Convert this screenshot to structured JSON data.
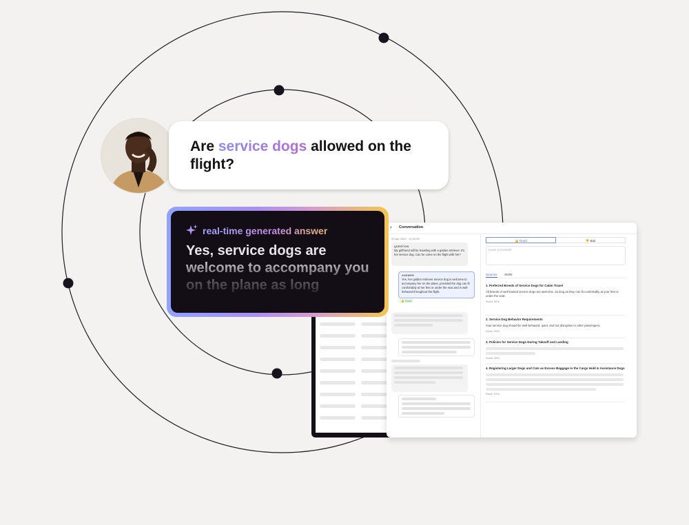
{
  "question": {
    "prefix": "Are ",
    "highlight": "service dogs",
    "suffix": " allowed on the flight?"
  },
  "answer_card": {
    "label": "real-time generated answer",
    "text": "Yes, service dogs are welcome to accompany you on the plane as long"
  },
  "panel": {
    "title": "Conversation",
    "timestamp": "22 Apr 2024 · 12:20:59",
    "question_tag": "QUESTION",
    "question_text": "My girlfriend will be traveling with a golden retriever. It's her service dog. Can he come on the flight with her?",
    "answer_tag": "ANSWER",
    "answer_text": "Yes, her golden retriever service dog is welcome to accompany her on the plane, provided the dog can fit comfortably at her feet or under the seat and is well-behaved throughout the flight.",
    "feedback_chip": "Good",
    "rating_good": "Good",
    "rating_bad": "Bad",
    "comment_placeholder": "Leave a comment",
    "tabs": [
      "Sources",
      "JSON"
    ],
    "sources": [
      {
        "title": "1. Preferred Breeds of Service Dogs for Cabin Travel",
        "desc": "All breeds of well-trained service dogs are welcome, as long as they can fit comfortably at your feet or under the seat.",
        "score": "Score: 92%"
      },
      {
        "title": "2. Service Dog Behavior Requirements",
        "desc": "Your service dog should be well-behaved, quiet, and not disruptive to other passengers.",
        "score": "Score: 92%"
      },
      {
        "title": "3. Policies for Service Dogs During Takeoff and Landing",
        "desc": "",
        "score": "Score: 92%"
      },
      {
        "title": "4. Registering Larger Dogs and Cats as Excess Baggage in the Cargo Hold & Assistance Dogs",
        "desc": "",
        "score": "Score: 91%"
      }
    ]
  },
  "colors": {
    "background": "#f3f2f1",
    "accent": "#4f64d8",
    "highlight_start": "#8b8cf0",
    "highlight_end": "#b46ad8",
    "card_dark": "#130d15"
  },
  "icons": [
    "sparkle-icon",
    "chevron-icon",
    "thumbs-up-icon",
    "thumbs-down-icon"
  ]
}
